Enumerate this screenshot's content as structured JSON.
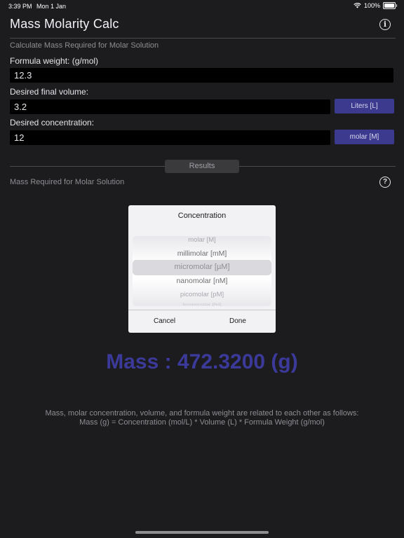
{
  "status": {
    "time": "3:39 PM",
    "date": "Mon 1 Jan",
    "battery": "100%",
    "battery_level": 1.0
  },
  "nav": {
    "title": "Mass Molarity Calc",
    "info_glyph": "i"
  },
  "form": {
    "subtitle": "Calculate Mass Required for Molar Solution",
    "formula_weight": {
      "label": "Formula weight:  (g/mol)",
      "value": "12.3"
    },
    "volume": {
      "label": "Desired final volume:",
      "value": "3.2",
      "unit": "Liters [L]"
    },
    "concentration": {
      "label": "Desired concentration:",
      "value": "12",
      "unit": "molar [M]"
    }
  },
  "results": {
    "tab": "Results",
    "subtitle": "Mass Required for Molar Solution",
    "help_glyph": "?",
    "mass": "Mass : 472.3200 (g)"
  },
  "picker": {
    "title": "Concentration",
    "options": [
      "molar [M]",
      "millimolar [mM]",
      "micromolar [µM]",
      "nanomolar [nM]",
      "picomolar [pM]",
      "femtomolar [fM]"
    ],
    "selected_index": 2,
    "cancel": "Cancel",
    "done": "Done"
  },
  "footer": {
    "line1": "Mass, molar concentration, volume, and formula weight are related to each other as follows:",
    "line2": "Mass (g) = Concentration (mol/L) * Volume (L) * Formula Weight (g/mol)"
  },
  "icons": [
    "wifi-icon",
    "battery-icon",
    "info-icon",
    "help-icon"
  ],
  "colors": {
    "accent": "#3b3a8e",
    "mass_text": "#3b3a9a",
    "background": "#1c1c1e"
  }
}
